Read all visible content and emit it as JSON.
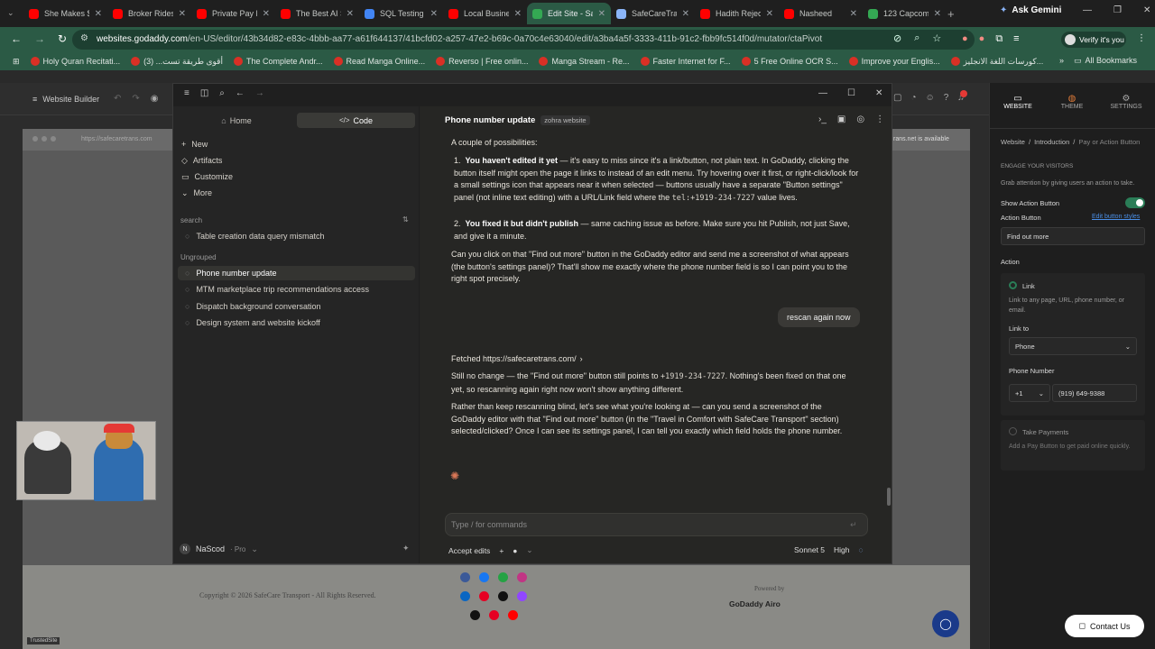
{
  "browser": {
    "tabs": [
      {
        "title": "She Makes $",
        "color": "#ff0000"
      },
      {
        "title": "Broker Rides",
        "color": "#ff0000"
      },
      {
        "title": "Private Pay N",
        "color": "#ff0000"
      },
      {
        "title": "The Best AI S",
        "color": "#ff0000"
      },
      {
        "title": "SQL Testing",
        "color": "#4285f4"
      },
      {
        "title": "Local Busine",
        "color": "#ff0000"
      },
      {
        "title": "Edit Site - Sa",
        "color": "#34a853"
      },
      {
        "title": "SafeCareTran",
        "color": "#8ab4f8"
      },
      {
        "title": "Hadith Rejec",
        "color": "#ff0000"
      },
      {
        "title": "Nasheed",
        "color": "#ff0000"
      },
      {
        "title": "123 Capcom",
        "color": "#34a853"
      }
    ],
    "ask_gemini": "Ask Gemini",
    "url_host": "websites.godaddy.com",
    "url_path": "/en-US/editor/43b34d82-e83c-4bbb-aa77-a61f644137/41bcfd02-a257-47e2-b69c-0a70c4e63040/edit/a3ba4a5f-3333-411b-91c2-fbb9fc514f0d/mutator/ctaPivot",
    "verify": "Verify it's you",
    "bookmarks": [
      "Holy Quran Recitati...",
      "أقوى طريقة تست... (3)",
      "The Complete Andr...",
      "Read Manga Online...",
      "Reverso | Free onlin...",
      "Manga Stream - Re...",
      "Faster Internet for F...",
      "5 Free Online OCR S...",
      "Improve your Englis...",
      "كورسات اللغة الانجليز..."
    ],
    "all_bookmarks": "All Bookmarks"
  },
  "builder": {
    "title": "Website Builder",
    "preview_url": "https://safecaretrans.com",
    "domain_note": "rans.net is available",
    "copyright": "Copyright © 2026 SafeCare Transport - All Rights Reserved.",
    "powered_by": "Powered by",
    "godaddy": "GoDaddy Airo",
    "contact_us": "Contact Us",
    "trusted": "TrustedSite"
  },
  "panel": {
    "tabs": [
      "WEBSITE",
      "THEME",
      "SETTINGS"
    ],
    "breadcrumb": [
      "Website",
      "Introduction",
      "Pay or Action Button"
    ],
    "section_title": "ENGAGE YOUR VISITORS",
    "section_desc": "Grab attention by giving users an action to take.",
    "show_action_button": "Show Action Button",
    "action_button_label": "Action Button",
    "edit_styles": "Edit button styles",
    "action_button_value": "Find out more",
    "action_label": "Action",
    "link_label": "Link",
    "link_desc": "Link to any page, URL, phone number, or email.",
    "link_to_label": "Link to",
    "link_to_value": "Phone",
    "phone_label": "Phone Number",
    "country_code": "+1",
    "phone_value": "(919) 649-9388",
    "take_payments": "Take Payments",
    "take_payments_desc": "Add a Pay Button to get paid online quickly."
  },
  "app": {
    "home_tab": "Home",
    "code_tab": "Code",
    "menu": [
      "New",
      "Artifacts",
      "Customize",
      "More"
    ],
    "search_label": "search",
    "search_items": [
      "Table creation data query mismatch"
    ],
    "ungrouped_label": "Ungrouped",
    "conversations": [
      "Phone number update",
      "MTM marketplace trip recommendations access",
      "Dispatch background conversation",
      "Design system and website kickoff"
    ],
    "user": "NaScod",
    "plan": "Pro",
    "chat_title": "Phone number update",
    "chat_project": "zohra website",
    "intro": "A couple of possibilities:",
    "point1_bold": "You haven't edited it yet",
    "point1_text": " — it's easy to miss since it's a link/button, not plain text. In GoDaddy, clicking the button itself might open the page it links to instead of an edit menu. Try hovering over it first, or right-click/look for a small settings icon that appears near it when selected — buttons usually have a separate \"Button settings\" panel (not inline text editing) with a URL/Link field where the ",
    "point1_code": "tel:+1919-234-7227",
    "point1_end": " value lives.",
    "point2_bold": "You fixed it but didn't publish",
    "point2_text": " — same caching issue as before. Make sure you hit Publish, not just Save, and give it a minute.",
    "ask_para": "Can you click on that \"Find out more\" button in the GoDaddy editor and send me a screenshot of what appears (the button's settings panel)? That'll show me exactly where the phone number field is so I can point you to the right spot precisely.",
    "user_msg": "rescan again now",
    "fetched": "Fetched https://safecaretrans.com/",
    "reply1_a": "Still no change — the \"Find out more\" button still points to ",
    "reply1_code": "+1919-234-7227",
    "reply1_b": ". Nothing's been fixed on that one yet, so rescanning again right now won't show anything different.",
    "reply2": "Rather than keep rescanning blind, let's see what you're looking at — can you send a screenshot of the GoDaddy editor with that \"Find out more\" button (in the \"Travel in Comfort with SafeCare Transport\" section) selected/clicked? Once I can see its settings panel, I can tell you exactly which field holds the phone number.",
    "input_placeholder": "Type / for commands",
    "accept_edits": "Accept edits",
    "model": "Sonnet 5",
    "effort": "High"
  }
}
